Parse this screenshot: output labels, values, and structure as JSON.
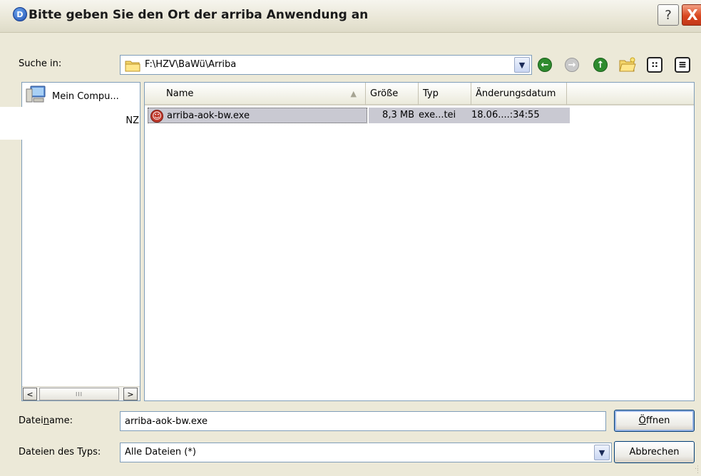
{
  "window": {
    "title": "Bitte geben Sie den Ort der arriba Anwendung an",
    "help_label": "?",
    "close_label": "X"
  },
  "lookin": {
    "label": "Suche in:",
    "path": "F:\\HZV\\BaWü\\Arriba"
  },
  "toolbar": {
    "icons": [
      "back-icon",
      "forward-icon",
      "up-folder-icon",
      "new-folder-icon",
      "view-menu-icon",
      "details-view-icon"
    ]
  },
  "places": {
    "items": [
      {
        "label": "Mein Compu...",
        "icon": "my-computer-icon"
      },
      {
        "label": "NZ",
        "icon": "folder-icon"
      }
    ],
    "scroll_left": "<",
    "scroll_right": ">",
    "scroll_thumb": "III"
  },
  "filelist": {
    "columns": [
      "Name",
      "Größe",
      "Typ",
      "Änderungsdatum"
    ],
    "sort_arrow": "▲",
    "rows": [
      {
        "name": "arriba-aok-bw.exe",
        "size": "8,3 MB",
        "type": "exe...tei",
        "modified": "18.06....:34:55",
        "selected": true
      }
    ]
  },
  "filename": {
    "label_pre": "Datei",
    "label_u": "n",
    "label_post": "ame:",
    "value": "arriba-aok-bw.exe"
  },
  "filetype": {
    "label": "Dateien des Typs:",
    "value": "Alle Dateien (*)"
  },
  "buttons": {
    "open_u": "Ö",
    "open_rest": "ffnen",
    "cancel": "Abbrechen"
  },
  "colors": {
    "dialog_bg": "#ece9d8",
    "selection": "#c9c9d2",
    "border": "#7f9db9",
    "nav_green": "#2e8b2e"
  }
}
